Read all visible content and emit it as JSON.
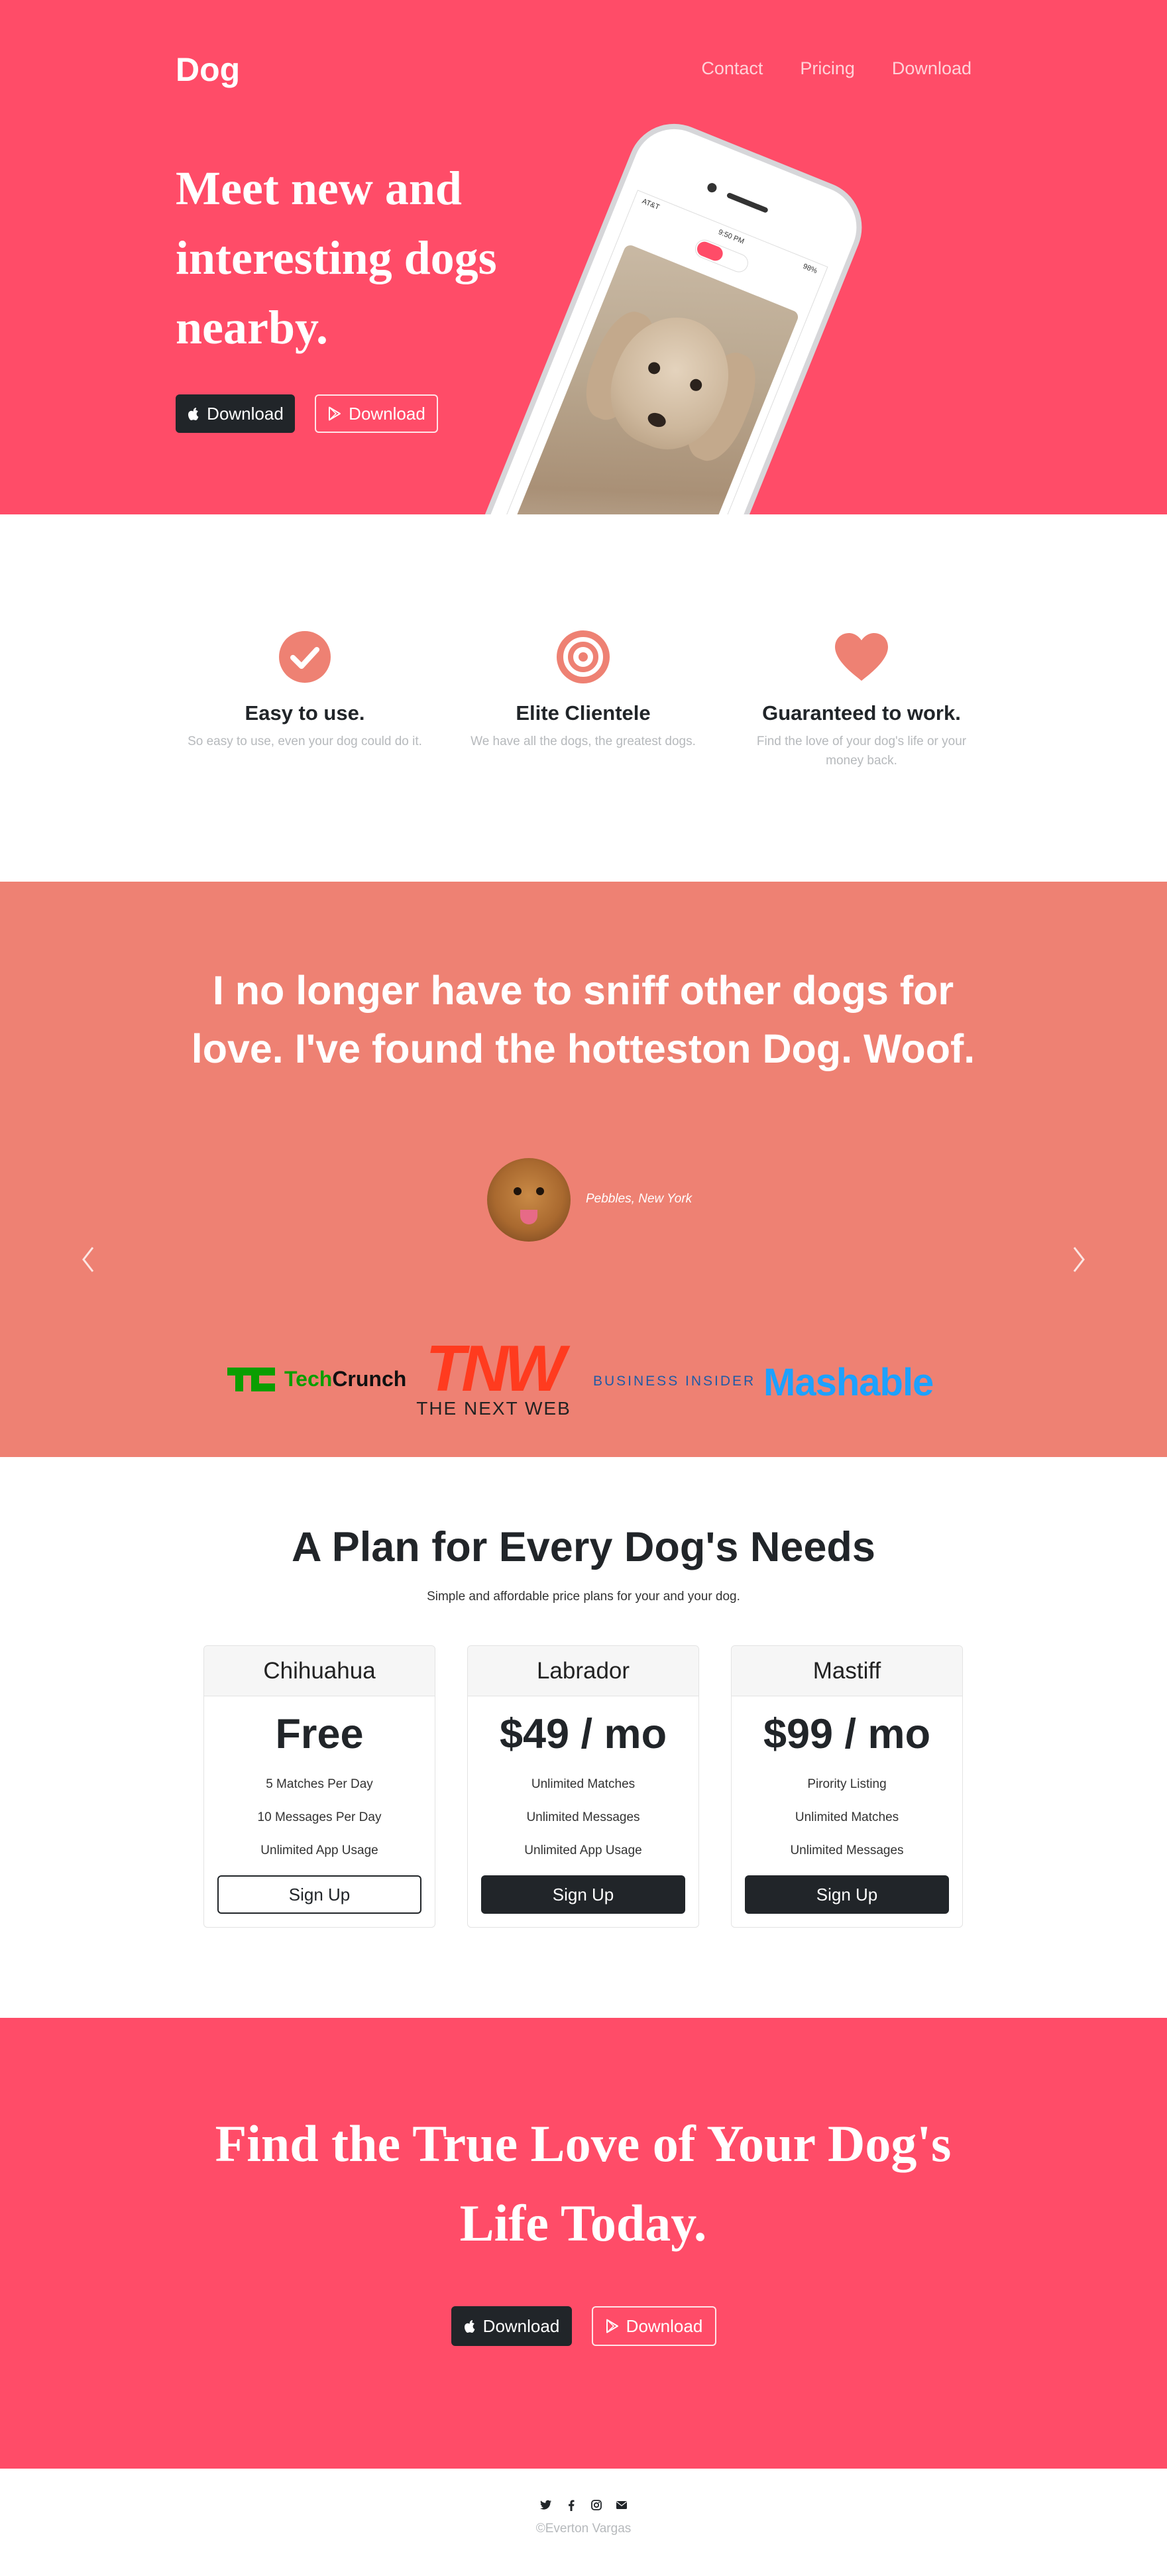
{
  "nav": {
    "brand": "Dog",
    "links": [
      "Contact",
      "Pricing",
      "Download"
    ]
  },
  "hero": {
    "title": "Meet new and interesting dogs nearby.",
    "download_ios": "Download",
    "download_android": "Download"
  },
  "phone": {
    "carrier": "AT&T",
    "time": "9:50 PM",
    "battery": "98%"
  },
  "features": [
    {
      "icon": "check-circle-icon",
      "title": "Easy to use.",
      "text": "So easy to use, even your dog could do it."
    },
    {
      "icon": "target-icon",
      "title": "Elite Clientele",
      "text": "We have all the dogs, the greatest dogs."
    },
    {
      "icon": "heart-icon",
      "title": "Guaranteed to work.",
      "text": "Find the love of your dog's life or your money back."
    }
  ],
  "testimonial": {
    "quote": "I no longer have to sniff other dogs for love. I've found the hotteston Dog. Woof.",
    "author": "Pebbles, New York"
  },
  "press": {
    "techcrunch_a": "Tech",
    "techcrunch_b": "Crunch",
    "tnw": "TNW",
    "tnw_sub": "THE NEXT WEB",
    "business_insider": "BUSINESS INSIDER",
    "mashable": "Mashable"
  },
  "pricing": {
    "title": "A Plan for Every Dog's Needs",
    "subtitle": "Simple and affordable price plans for your and your dog.",
    "plans": [
      {
        "name": "Chihuahua",
        "price": "Free",
        "features": [
          "5 Matches Per Day",
          "10 Messages Per Day",
          "Unlimited App Usage"
        ],
        "cta": "Sign Up"
      },
      {
        "name": "Labrador",
        "price": "$49 / mo",
        "features": [
          "Unlimited Matches",
          "Unlimited Messages",
          "Unlimited App Usage"
        ],
        "cta": "Sign Up"
      },
      {
        "name": "Mastiff",
        "price": "$99 / mo",
        "features": [
          "Pirority Listing",
          "Unlimited Matches",
          "Unlimited Messages"
        ],
        "cta": "Sign Up"
      }
    ]
  },
  "cta": {
    "title": "Find the True Love of Your Dog's Life Today.",
    "download_ios": "Download",
    "download_android": "Download"
  },
  "footer": {
    "copyright": "©Everton Vargas"
  },
  "colors": {
    "primary": "#ff4c68",
    "coral": "#ee8173",
    "dark": "#212529",
    "muted": "#b6b9bc"
  }
}
